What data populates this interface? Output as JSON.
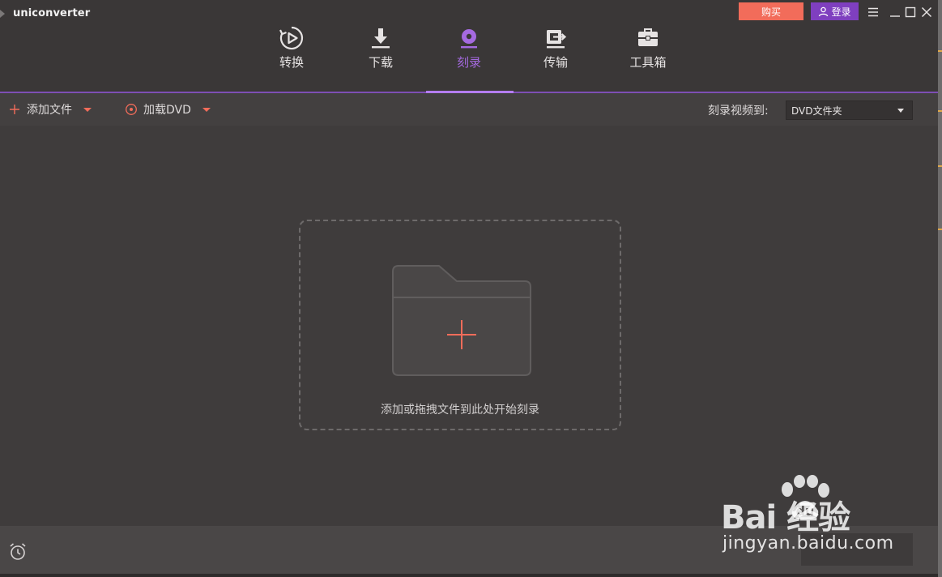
{
  "app": {
    "title": "uniconverter"
  },
  "header": {
    "buy_label": "购买",
    "login_label": "登录"
  },
  "nav": {
    "items": [
      {
        "label": "转换",
        "icon": "play-circle-icon"
      },
      {
        "label": "下载",
        "icon": "download-icon"
      },
      {
        "label": "刻录",
        "icon": "disc-icon",
        "active": true
      },
      {
        "label": "传输",
        "icon": "transfer-icon"
      },
      {
        "label": "工具箱",
        "icon": "toolbox-icon"
      }
    ]
  },
  "toolbar": {
    "add_file_label": "添加文件",
    "load_dvd_label": "加载DVD",
    "burn_to_label": "刻录视频到:",
    "burn_target_value": "DVD文件夹"
  },
  "dropzone": {
    "text": "添加或拖拽文件到此处开始刻录"
  },
  "watermark": {
    "brand": "Bai  经验",
    "url": "jingyan.baidu.com"
  },
  "colors": {
    "accent_purple": "#a56ae0",
    "accent_coral": "#f26c5a",
    "login_purple": "#7f3fbf",
    "background": "#3f3c3c"
  }
}
